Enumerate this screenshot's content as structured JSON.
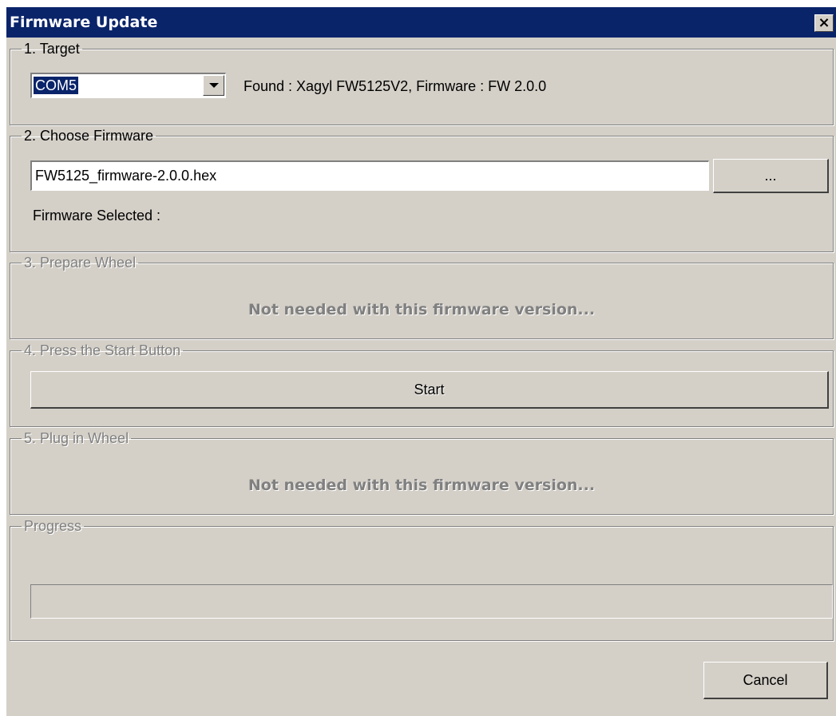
{
  "window": {
    "title": "Firmware Update",
    "close_glyph": "×",
    "close_icon": "close-icon"
  },
  "target": {
    "legend": "1. Target",
    "port_selected": "COM5",
    "found_text": "Found : Xagyl FW5125V2,  Firmware : FW 2.0.0"
  },
  "choose_firmware": {
    "legend": "2. Choose Firmware",
    "file_value": "FW5125_firmware-2.0.0.hex",
    "browse_label": "...",
    "selected_label": "Firmware Selected :"
  },
  "prepare_wheel": {
    "legend": "3. Prepare Wheel",
    "notice": "Not needed with this firmware version..."
  },
  "press_start": {
    "legend": "4. Press the Start Button",
    "start_label": "Start"
  },
  "plug_in": {
    "legend": "5. Plug in Wheel",
    "notice": "Not needed with this firmware version..."
  },
  "progress": {
    "legend": "Progress",
    "percent": 0
  },
  "footer": {
    "cancel_label": "Cancel"
  },
  "colors": {
    "face": "#d4d0c8",
    "titlebar": "#0a246a",
    "disabled": "#808080"
  }
}
